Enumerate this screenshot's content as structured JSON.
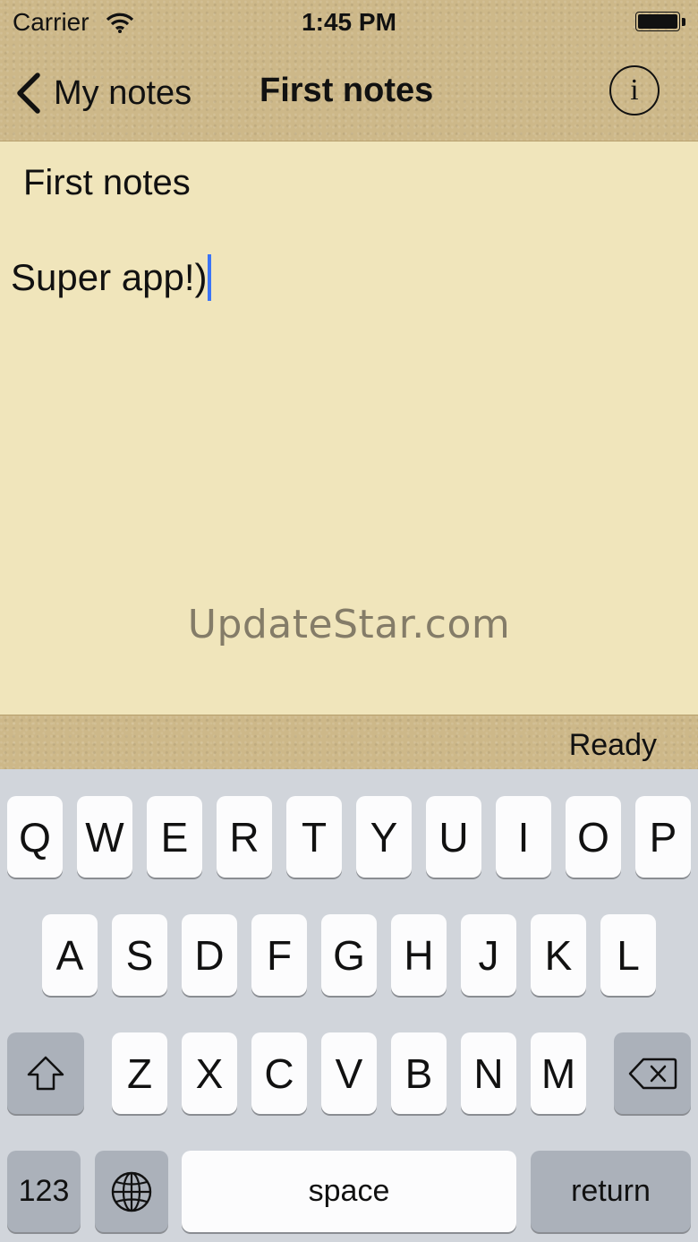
{
  "status_bar": {
    "carrier": "Carrier",
    "time": "1:45 PM"
  },
  "nav": {
    "back_label": "My notes",
    "title": "First notes",
    "info_label": "i"
  },
  "note": {
    "title": "First notes",
    "body": "Super app!)"
  },
  "watermark": "UpdateStar.com",
  "save_status": "Ready",
  "keyboard": {
    "row1": [
      "Q",
      "W",
      "E",
      "R",
      "T",
      "Y",
      "U",
      "I",
      "O",
      "P"
    ],
    "row2": [
      "A",
      "S",
      "D",
      "F",
      "G",
      "H",
      "J",
      "K",
      "L"
    ],
    "row3": [
      "Z",
      "X",
      "C",
      "V",
      "B",
      "N",
      "M"
    ],
    "numbers_label": "123",
    "space_label": "space",
    "return_label": "return"
  },
  "colors": {
    "note_background": "#f0e5bb",
    "leather": "#cdb889",
    "caret": "#3b74f6",
    "keyboard_background": "#d1d5db"
  }
}
